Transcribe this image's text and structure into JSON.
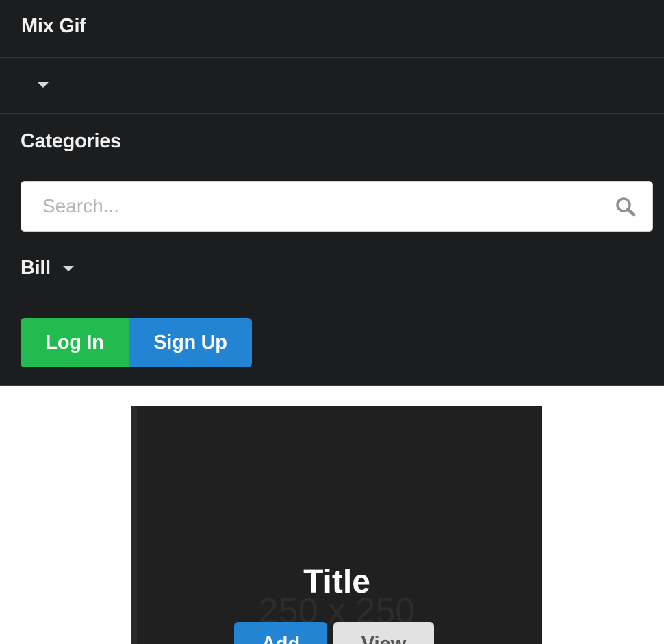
{
  "navbar": {
    "brand": "Mix Gif",
    "categories_label": "Categories",
    "search": {
      "placeholder": "Search...",
      "value": ""
    },
    "user_menu_label": "Bill",
    "login_label": "Log In",
    "signup_label": "Sign Up",
    "colors": {
      "background": "#1c1d1f",
      "login": "#22bb4f",
      "signup": "#2384d4"
    }
  },
  "card": {
    "placeholder_text": "250 x 250",
    "title": "Title",
    "add_label": "Add",
    "view_label": "View",
    "colors": {
      "add": "#2384d4",
      "view": "#e2e2e2"
    }
  },
  "icons": [
    "caret-down-icon",
    "search-icon"
  ]
}
